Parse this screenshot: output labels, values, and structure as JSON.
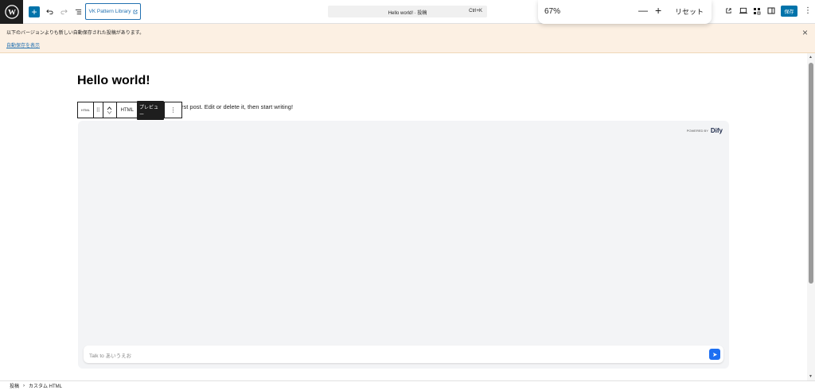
{
  "toolbar": {
    "add_label": "+",
    "vk_label": "VK Pattern Library",
    "command_title": "Hello world! · 投稿",
    "command_shortcut": "Ctrl+K",
    "save_label": "保存"
  },
  "zoom": {
    "percent": "67%",
    "reset_label": "リセット"
  },
  "notice": {
    "message": "以下のバージョンよりも新しい自動保存された投稿があります。",
    "link_label": "自動保存を表示"
  },
  "post": {
    "title": "Hello world!",
    "body_visible": "rst post. Edit or delete it, then start writing!"
  },
  "block_toolbar": {
    "html_icon_label": "HTML",
    "mode_html": "HTML",
    "mode_preview": "プレビュー"
  },
  "dify": {
    "powered_by": "POWERED BY",
    "brand": "Dify",
    "input_placeholder": "Talk to あいうえお"
  },
  "breadcrumb": {
    "items": [
      "投稿",
      "カスタム HTML"
    ]
  },
  "colors": {
    "accent": "#0073aa",
    "notice_bg": "#fcf0e3",
    "send": "#1d6ff2"
  }
}
